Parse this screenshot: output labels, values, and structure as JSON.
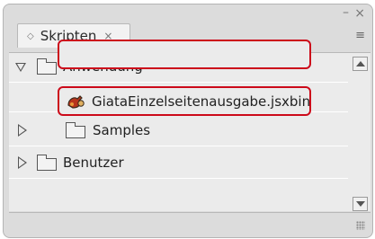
{
  "window": {
    "minimize_symbol": "–",
    "close_symbol": "×",
    "menu_symbol": "≡"
  },
  "tab": {
    "icon_symbol": "◇",
    "label": "Skripten",
    "close_symbol": "×"
  },
  "tree": {
    "items": [
      {
        "label": "Anwendung",
        "expanded": true,
        "level": 0
      },
      {
        "label": "GiataEinzelseitenausgabe.jsxbin",
        "level": 1,
        "type": "script",
        "highlighted": true
      },
      {
        "label": "Samples",
        "expanded": false,
        "level": 1
      },
      {
        "label": "Benutzer",
        "expanded": false,
        "level": 0
      }
    ]
  },
  "colors": {
    "panel_bg": "#dcdcdc",
    "list_bg": "#ebebeb",
    "highlight_border": "#cc0a1a",
    "text": "#222222"
  }
}
